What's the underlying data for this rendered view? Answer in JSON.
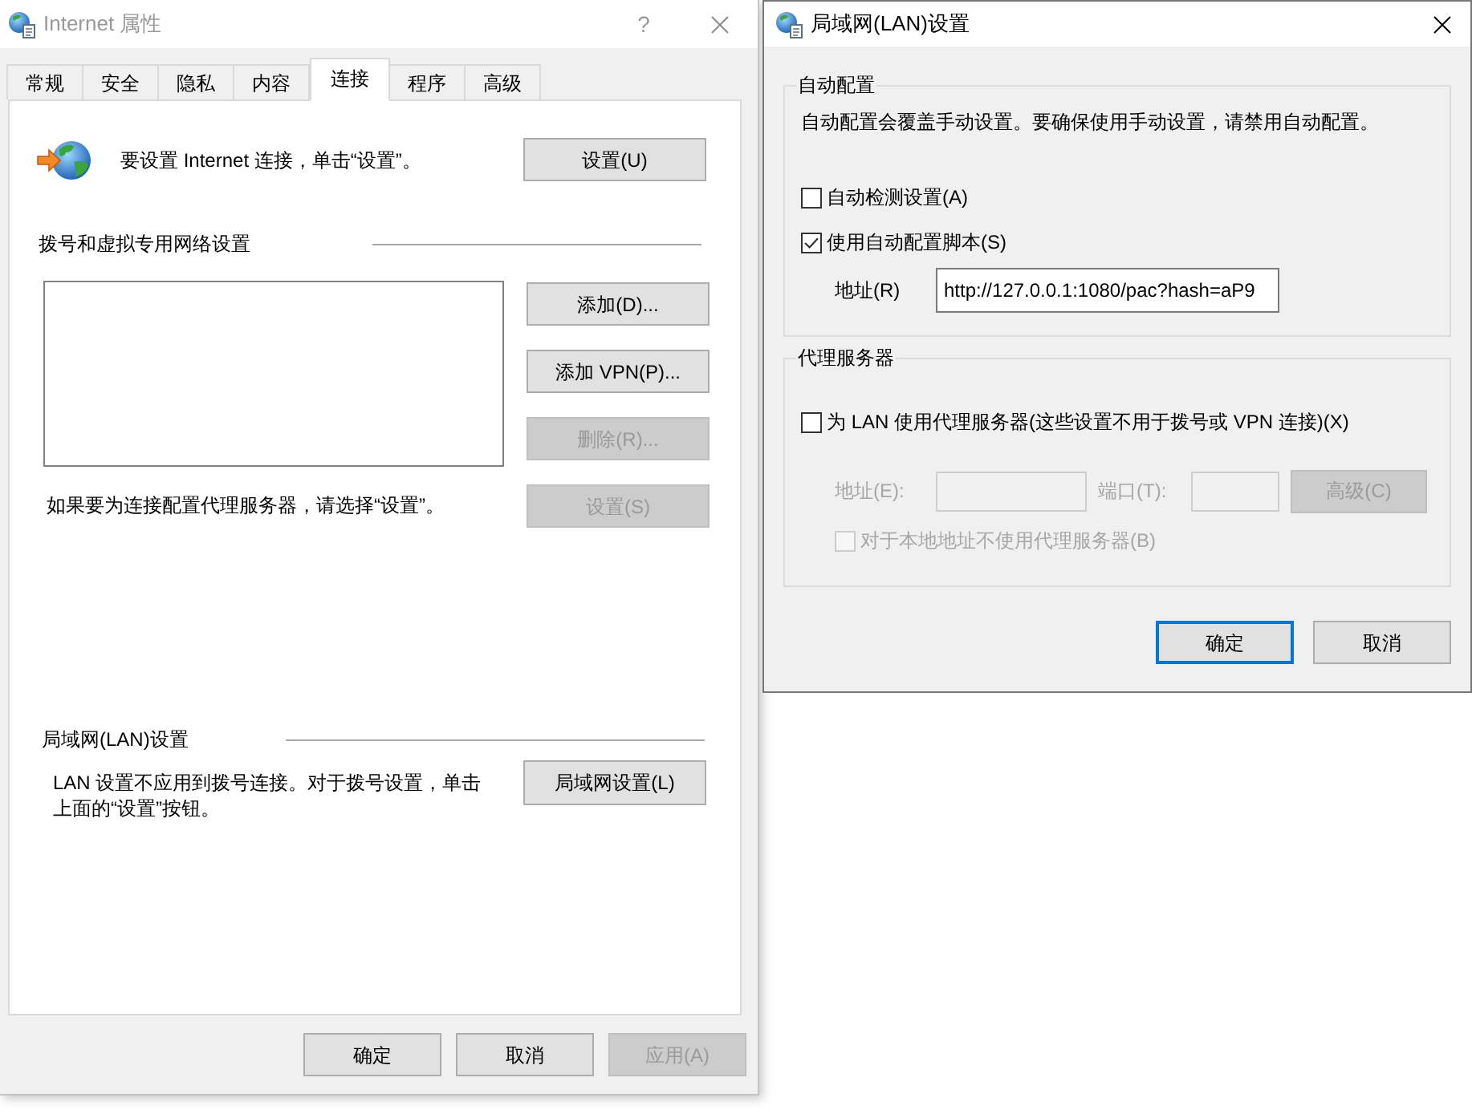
{
  "internet_properties": {
    "title": "Internet 属性",
    "active": false,
    "help_button": "?",
    "tabs": [
      {
        "label": "常规",
        "selected": false
      },
      {
        "label": "安全",
        "selected": false
      },
      {
        "label": "隐私",
        "selected": false
      },
      {
        "label": "内容",
        "selected": false
      },
      {
        "label": "连接",
        "selected": true
      },
      {
        "label": "程序",
        "selected": false
      },
      {
        "label": "高级",
        "selected": false
      }
    ],
    "setup": {
      "text": "要设置 Internet 连接，单击“设置”。",
      "button": "设置(U)"
    },
    "dialup_section": {
      "heading": "拨号和虚拟专用网络设置",
      "buttons": [
        {
          "label": "添加(D)...",
          "disabled": false
        },
        {
          "label": "添加 VPN(P)...",
          "disabled": false
        },
        {
          "label": "删除(R)...",
          "disabled": true
        },
        {
          "label": "设置(S)",
          "disabled": true
        }
      ],
      "proxy_note": "如果要为连接配置代理服务器，请选择“设置”。"
    },
    "lan_section": {
      "heading": "局域网(LAN)设置",
      "text": "LAN 设置不应用到拨号连接。对于拨号设置，单击上面的“设置”按钮。",
      "button": "局域网设置(L)"
    },
    "footer_buttons": [
      {
        "label": "确定",
        "disabled": false
      },
      {
        "label": "取消",
        "disabled": false
      },
      {
        "label": "应用(A)",
        "disabled": true
      }
    ]
  },
  "lan_settings": {
    "title": "局域网(LAN)设置",
    "active": true,
    "auto_config": {
      "heading": "自动配置",
      "text": "自动配置会覆盖手动设置。要确保使用手动设置，请禁用自动配置。",
      "options": [
        {
          "label": "自动检测设置(A)",
          "checked": false
        },
        {
          "label": "使用自动配置脚本(S)",
          "checked": true
        }
      ],
      "address": {
        "label": "地址(R)",
        "value": "http://127.0.0.1:1080/pac?hash=aP9"
      }
    },
    "proxy_server": {
      "heading": "代理服务器",
      "use_proxy": {
        "label": "为 LAN 使用代理服务器(这些设置不用于拨号或 VPN 连接)(X)",
        "checked": false
      },
      "fields_disabled": true,
      "address_label": "地址(E):",
      "port_label": "端口(T):",
      "advanced_button": "高级(C)",
      "bypass_local": {
        "label": "对于本地地址不使用代理服务器(B)",
        "checked": false
      }
    },
    "buttons": [
      {
        "label": "确定",
        "default": true
      },
      {
        "label": "取消",
        "default": false
      }
    ]
  }
}
